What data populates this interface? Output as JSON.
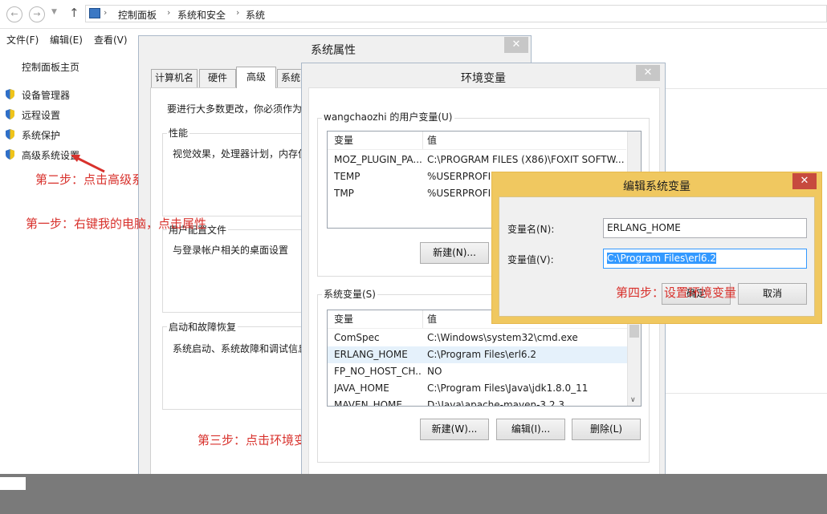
{
  "explorer": {
    "breadcrumb": [
      "控制面板",
      "系统和安全",
      "系统"
    ],
    "menu": [
      "文件(F)",
      "编辑(E)",
      "查看(V)"
    ],
    "nav_home": "控制面板主页",
    "nav_links": [
      "设备管理器",
      "远程设置",
      "系统保护",
      "高级系统设置"
    ]
  },
  "annotations": {
    "step1": "第一步：右键我的电脑，点击属性",
    "step2": "第二步：点击高级系统设置",
    "step3": "第三步：点击环境变量",
    "step4": "第四步：设置环境变量"
  },
  "sysprops": {
    "title": "系统属性",
    "tabs": [
      "计算机名",
      "硬件",
      "高级",
      "系统"
    ],
    "admin_note": "要进行大多数更改，你必须作为",
    "perf_label": "性能",
    "perf_text": "视觉效果，处理器计划，内存使",
    "profile_label": "用户配置文件",
    "profile_text": "与登录帐户相关的桌面设置",
    "startup_label": "启动和故障恢复",
    "startup_text": "系统启动、系统故障和调试信息"
  },
  "envvars": {
    "title": "环境变量",
    "user_group_label": "wangchaozhi 的用户变量(U)",
    "col_var": "变量",
    "col_val": "值",
    "user_vars": [
      {
        "name": "MOZ_PLUGIN_PA...",
        "value": "C:\\PROGRAM FILES (X86)\\FOXIT SOFTW..."
      },
      {
        "name": "TEMP",
        "value": "%USERPROFIL"
      },
      {
        "name": "TMP",
        "value": "%USERPROFIL"
      }
    ],
    "user_new_btn": "新建(N)...",
    "sys_group_label": "系统变量(S)",
    "sys_vars": [
      {
        "name": "ComSpec",
        "value": "C:\\Windows\\system32\\cmd.exe"
      },
      {
        "name": "ERLANG_HOME",
        "value": "C:\\Program Files\\erl6.2"
      },
      {
        "name": "FP_NO_HOST_CH...",
        "value": "NO"
      },
      {
        "name": "JAVA_HOME",
        "value": "C:\\Program Files\\Java\\jdk1.8.0_11"
      },
      {
        "name": "MAVEN_HOME",
        "value": "D:\\Java\\apache-maven-3.2.3"
      }
    ],
    "sys_new_btn": "新建(W)...",
    "sys_edit_btn": "编辑(I)...",
    "sys_delete_btn": "删除(L)"
  },
  "editvar": {
    "title": "编辑系统变量",
    "name_label": "变量名(N):",
    "name_value": "ERLANG_HOME",
    "value_label": "变量值(V):",
    "value_value": "C:\\Program Files\\erl6.2",
    "ok_btn": "确定",
    "cancel_btn": "取消"
  },
  "colors": {
    "accent_red": "#d8312c",
    "selection": "#3399ff",
    "dialog_border": "#e6b84d"
  }
}
